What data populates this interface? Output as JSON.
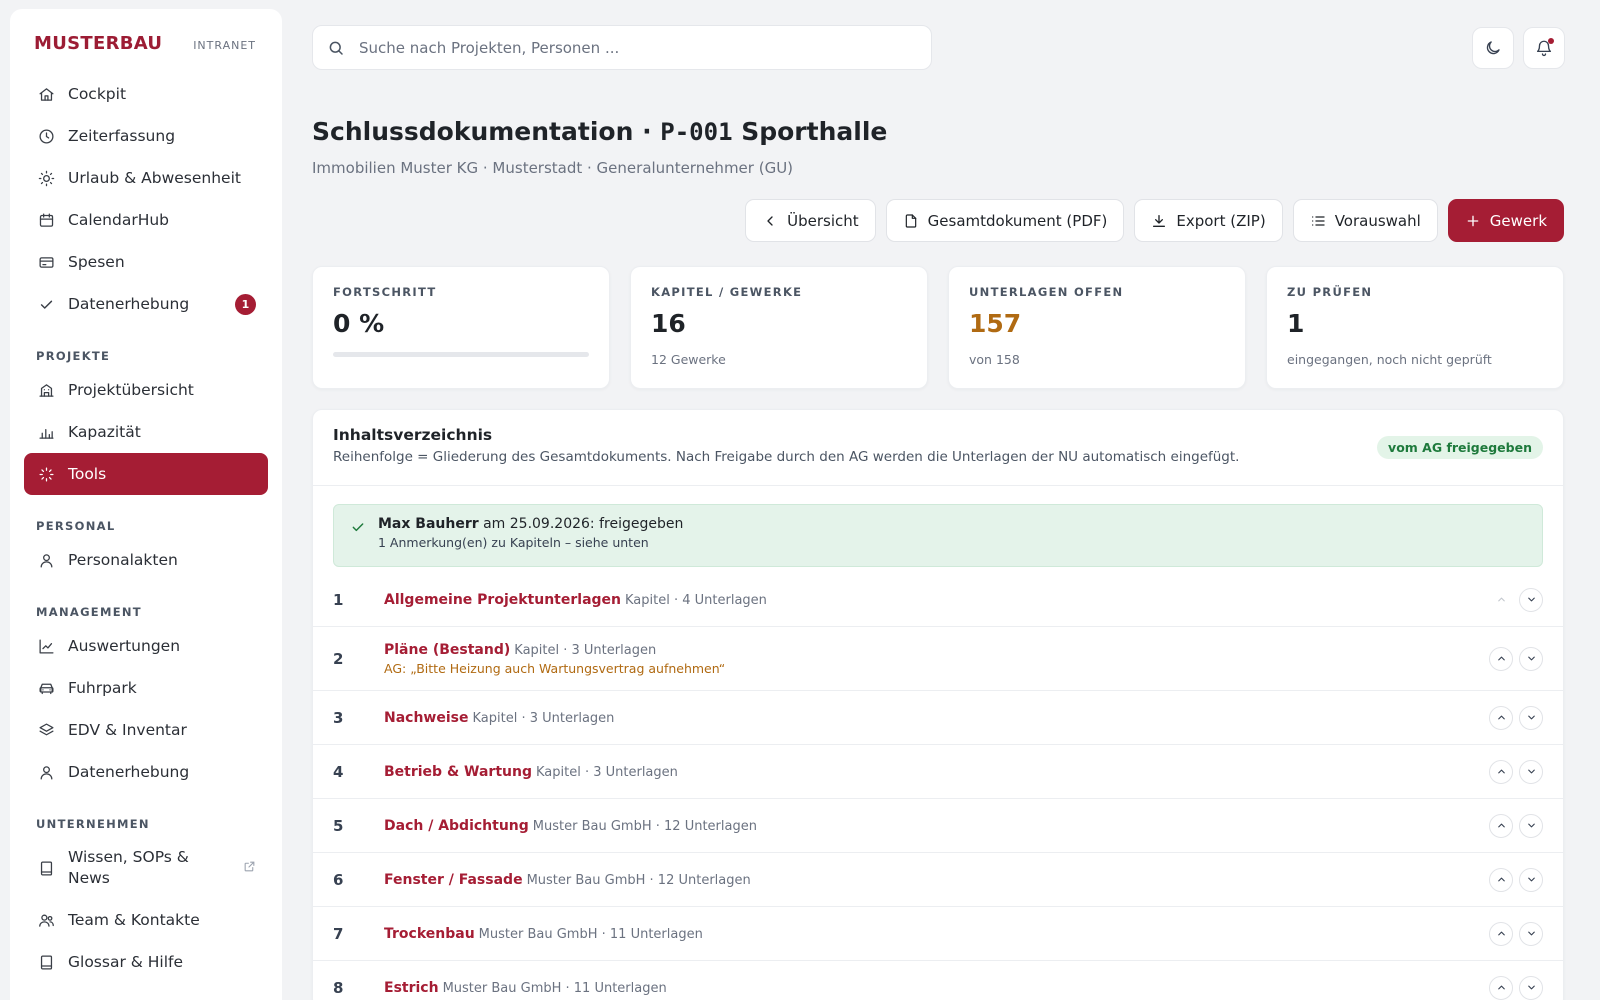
{
  "brand": {
    "name": "MUSTERBAU",
    "tag": "INTRANET"
  },
  "nav_main": [
    {
      "label": "Cockpit",
      "icon": "home-icon"
    },
    {
      "label": "Zeiterfassung",
      "icon": "clock-icon"
    },
    {
      "label": "Urlaub & Abwesenheit",
      "icon": "sun-icon"
    },
    {
      "label": "CalendarHub",
      "icon": "calendar-icon"
    },
    {
      "label": "Spesen",
      "icon": "credit-card-icon"
    },
    {
      "label": "Datenerhebung",
      "icon": "check-icon",
      "badge": "1"
    }
  ],
  "sections": {
    "projekte": "PROJEKTE",
    "personal": "PERSONAL",
    "management": "MANAGEMENT",
    "unternehmen": "UNTERNEHMEN"
  },
  "nav_projekte": [
    {
      "label": "Projektübersicht",
      "icon": "building-icon"
    },
    {
      "label": "Kapazität",
      "icon": "bar-chart-icon"
    },
    {
      "label": "Tools",
      "icon": "loader-icon",
      "active": true
    }
  ],
  "nav_personal": [
    {
      "label": "Personalakten",
      "icon": "user-icon"
    }
  ],
  "nav_management": [
    {
      "label": "Auswertungen",
      "icon": "line-chart-icon"
    },
    {
      "label": "Fuhrpark",
      "icon": "car-icon"
    },
    {
      "label": "EDV & Inventar",
      "icon": "layers-icon"
    },
    {
      "label": "Datenerhebung",
      "icon": "user-icon"
    }
  ],
  "nav_unternehmen": [
    {
      "label": "Wissen, SOPs & News",
      "icon": "book-icon",
      "external": true
    },
    {
      "label": "Team & Kontakte",
      "icon": "users-icon"
    },
    {
      "label": "Glossar & Hilfe",
      "icon": "book-icon"
    }
  ],
  "search": {
    "placeholder": "Suche nach Projekten, Personen ..."
  },
  "header": {
    "title_prefix": "Schlussdokumentation · ",
    "title_code": "P-001",
    "title_suffix": " Sporthalle",
    "subtitle": "Immobilien Muster KG · Musterstadt · Generalunternehmer (GU)"
  },
  "actions": {
    "overview": "Übersicht",
    "pdf": "Gesamtdokument (PDF)",
    "zip": "Export (ZIP)",
    "preselect": "Vorauswahl",
    "add": "Gewerk"
  },
  "stats": {
    "progress": {
      "label": "FORTSCHRITT",
      "value": "0 %",
      "fraction": 0
    },
    "chapters": {
      "label": "KAPITEL / GEWERKE",
      "value": "16",
      "sub": "12 Gewerke"
    },
    "open": {
      "label": "UNTERLAGEN OFFEN",
      "value": "157",
      "sub": "von 158",
      "color": "#b06a12"
    },
    "review": {
      "label": "ZU PRÜFEN",
      "value": "1",
      "sub": "eingegangen, noch nicht geprüft"
    }
  },
  "toc": {
    "title": "Inhaltsverzeichnis",
    "description": "Reihenfolge = Gliederung des Gesamtdokuments. Nach Freigabe durch den AG werden die Unterlagen der NU automatisch eingefügt.",
    "status": "vom AG freigegeben",
    "approval": {
      "name": "Max Bauherr",
      "text": " am 25.09.2026: freigegeben",
      "note": "1 Anmerkung(en) zu Kapiteln – siehe unten"
    },
    "rows": [
      {
        "num": "1",
        "name": "Allgemeine Projektunterlagen",
        "meta": "Kapitel · 4 Unterlagen",
        "note": ""
      },
      {
        "num": "2",
        "name": "Pläne (Bestand)",
        "meta": "Kapitel · 3 Unterlagen",
        "note": "AG: „Bitte Heizung auch Wartungsvertrag aufnehmen“"
      },
      {
        "num": "3",
        "name": "Nachweise",
        "meta": "Kapitel · 3 Unterlagen",
        "note": ""
      },
      {
        "num": "4",
        "name": "Betrieb & Wartung",
        "meta": "Kapitel · 3 Unterlagen",
        "note": ""
      },
      {
        "num": "5",
        "name": "Dach / Abdichtung",
        "meta": "Muster Bau GmbH · 12 Unterlagen",
        "note": ""
      },
      {
        "num": "6",
        "name": "Fenster / Fassade",
        "meta": "Muster Bau GmbH · 12 Unterlagen",
        "note": ""
      },
      {
        "num": "7",
        "name": "Trockenbau",
        "meta": "Muster Bau GmbH · 11 Unterlagen",
        "note": ""
      },
      {
        "num": "8",
        "name": "Estrich",
        "meta": "Muster Bau GmbH · 11 Unterlagen",
        "note": ""
      }
    ]
  },
  "colors": {
    "brand": "#a51d34",
    "warn": "#b06a12",
    "success": "#1e7a3c"
  }
}
